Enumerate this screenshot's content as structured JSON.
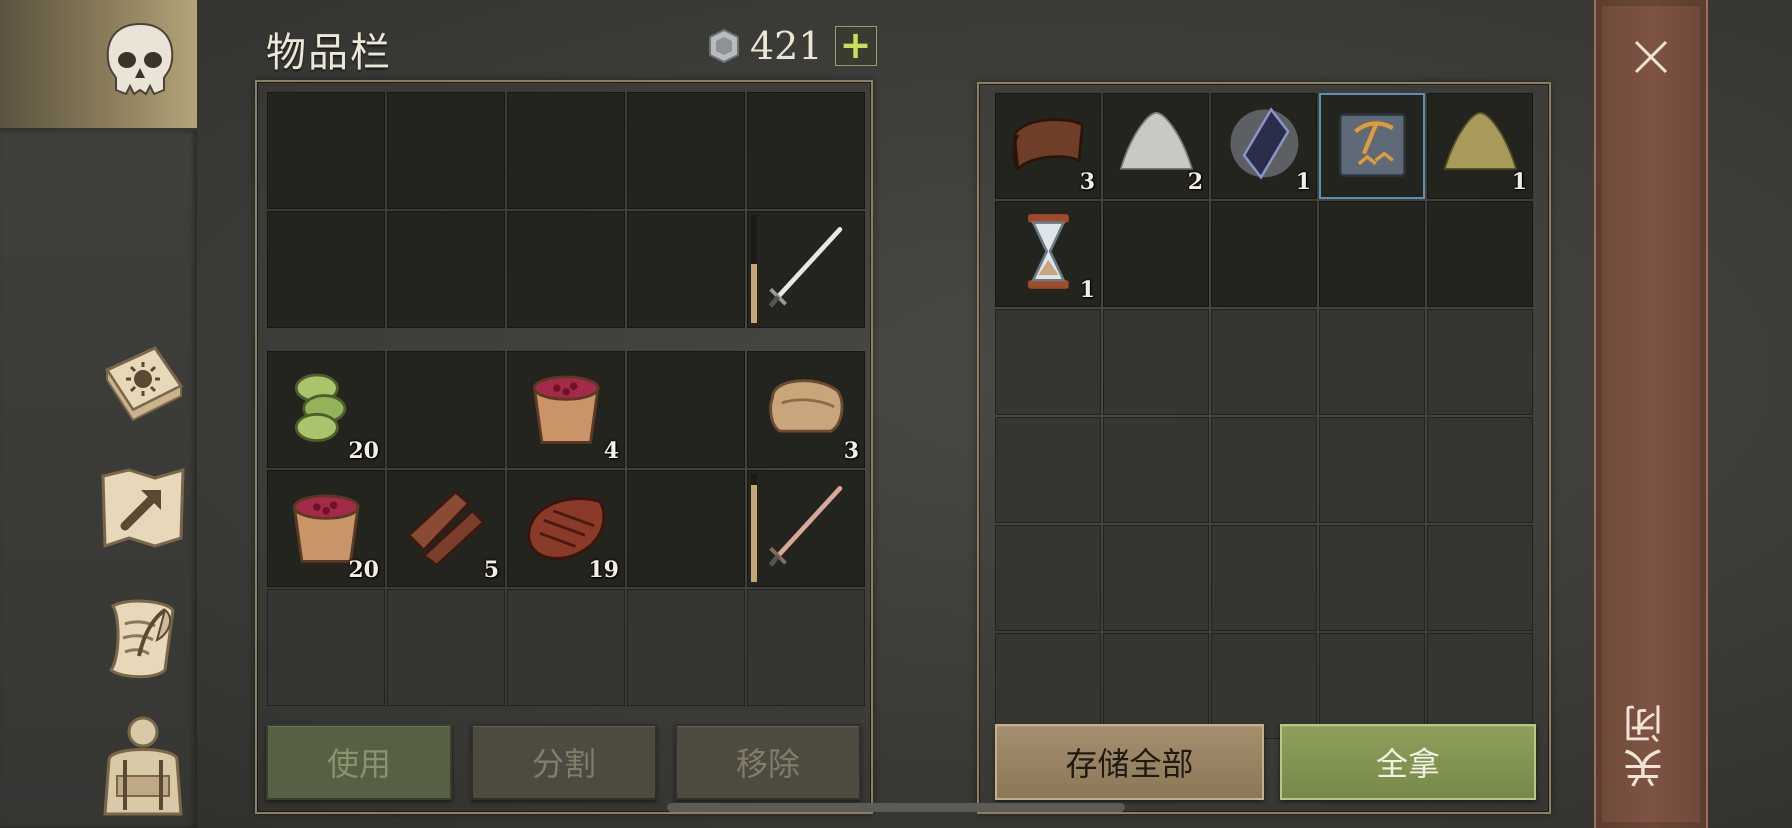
{
  "inventory": {
    "title": "物品栏",
    "currency": {
      "amount": "421",
      "icon": "silver-coin-icon",
      "add_label": "+"
    },
    "equip_slots": [
      {
        "item": null
      },
      {
        "item": null
      },
      {
        "item": null
      },
      {
        "item": null
      },
      {
        "item": null
      },
      {
        "item": null
      },
      {
        "item": null
      },
      {
        "item": null
      },
      {
        "item": null
      },
      {
        "item": "iron-sword-icon",
        "durability": 0.55
      }
    ],
    "bag_slots": [
      {
        "item": "leaf-wraps-icon",
        "qty": "20"
      },
      {
        "item": null
      },
      {
        "item": "berry-bucket-icon",
        "qty": "4"
      },
      {
        "item": null
      },
      {
        "item": "cloth-roll-icon",
        "qty": "3"
      },
      {
        "item": "berry-bucket-icon",
        "qty": "20"
      },
      {
        "item": "bark-strips-icon",
        "qty": "5"
      },
      {
        "item": "cooked-steak-icon",
        "qty": "19"
      },
      {
        "item": null
      },
      {
        "item": "copper-sword-icon",
        "durability": 0.9
      },
      {
        "item": null
      },
      {
        "item": null
      },
      {
        "item": null
      },
      {
        "item": null
      },
      {
        "item": null
      }
    ],
    "buttons": {
      "use": "使用",
      "split": "分割",
      "remove": "移除"
    }
  },
  "storage": {
    "slots": [
      {
        "item": "leather-scroll-icon",
        "qty": "3"
      },
      {
        "item": "sand-pile-icon",
        "qty": "2"
      },
      {
        "item": "dark-crystal-icon",
        "qty": "1"
      },
      {
        "item": "pickaxe-book-icon",
        "qty": "",
        "selected": true
      },
      {
        "item": "sulfur-pile-icon",
        "qty": "1"
      },
      {
        "item": "hourglass-icon",
        "qty": "1"
      }
    ],
    "buttons": {
      "store_all": "存储全部",
      "take_all": "全拿"
    }
  },
  "sidebar": {
    "items": [
      {
        "name": "character-tab",
        "icon": "skull-icon",
        "active": true
      },
      {
        "name": "skills-tab",
        "icon": "sun-book-icon"
      },
      {
        "name": "map-tab",
        "icon": "map-icon"
      },
      {
        "name": "quests-tab",
        "icon": "quill-scroll-icon"
      },
      {
        "name": "equipment-tab",
        "icon": "backpack-icon"
      }
    ]
  },
  "close": {
    "label": "关闭",
    "icon": "close-icon"
  },
  "colors": {
    "accent_green": "#8ea05b",
    "close_bar": "#7e5444",
    "selected_outline": "#5d8fb3"
  }
}
